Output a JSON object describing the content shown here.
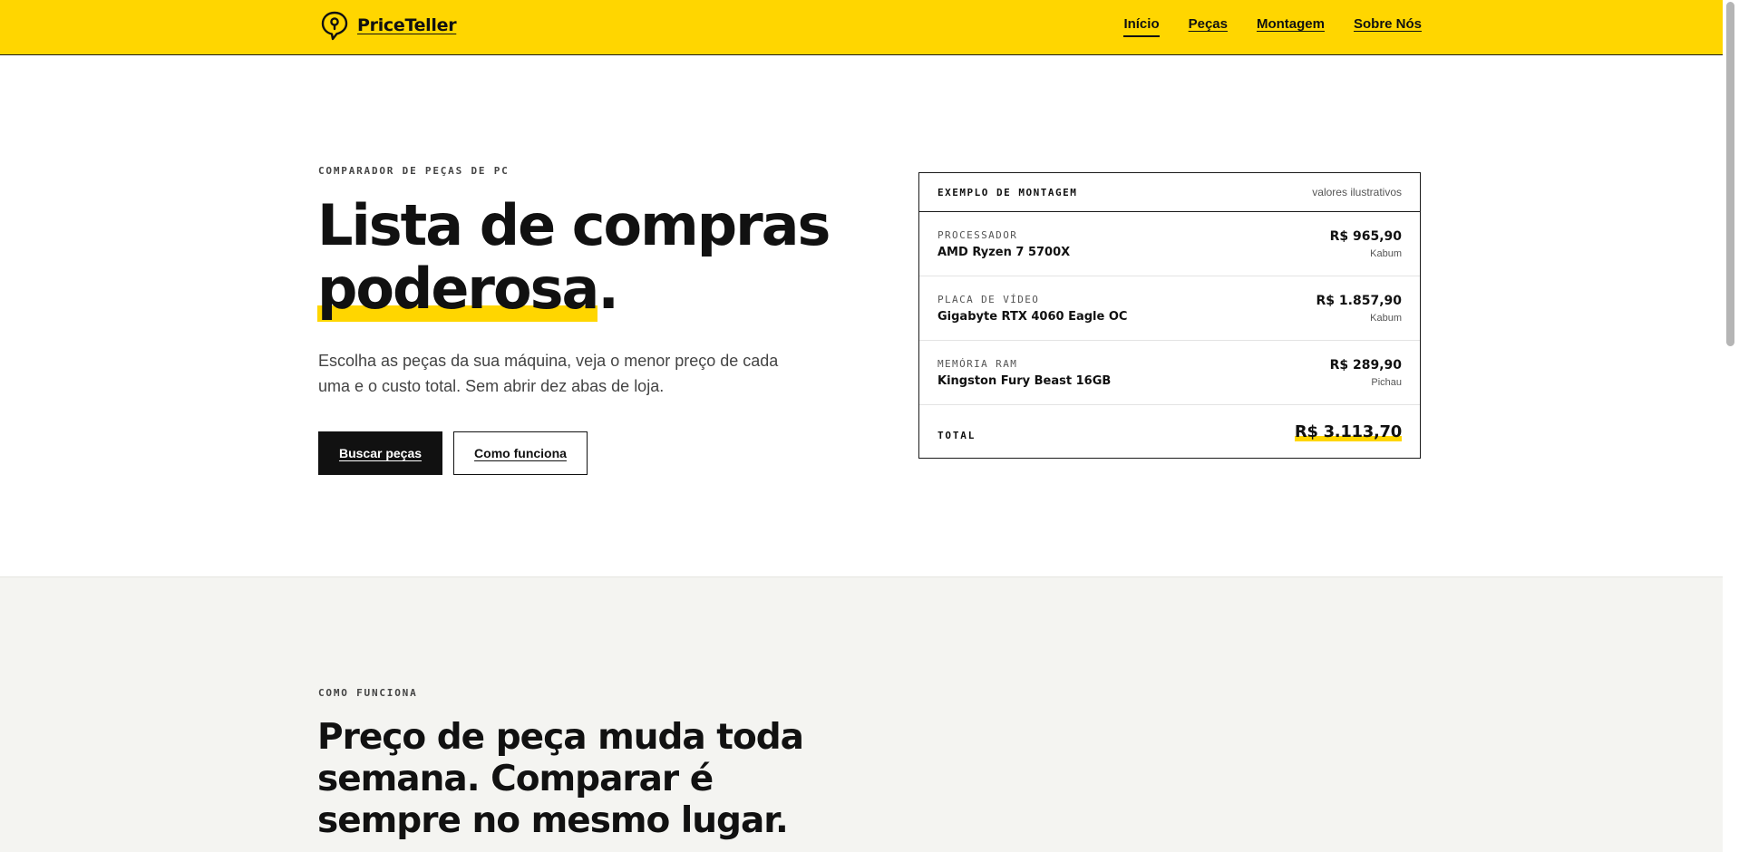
{
  "brand": {
    "name": "PriceTeller",
    "icon": "speech-bubble-logo-icon",
    "accent": "#ffd600"
  },
  "nav": {
    "items": [
      {
        "label": "Início",
        "active": true
      },
      {
        "label": "Peças",
        "active": false
      },
      {
        "label": "Montagem",
        "active": false
      },
      {
        "label": "Sobre Nós",
        "active": false
      }
    ]
  },
  "hero": {
    "eyebrow": "COMPARADOR DE PEÇAS DE PC",
    "title_line1": "Lista de compras",
    "title_highlight": "poderosa",
    "title_end": ".",
    "subtitle": "Escolha as peças da sua máquina, veja o menor preço de cada uma e o custo total. Sem abrir dez abas de loja.",
    "primary_button": "Buscar peças",
    "secondary_button": "Como funciona"
  },
  "example": {
    "title": "EXEMPLO DE MONTAGEM",
    "note": "valores ilustrativos",
    "items": [
      {
        "category": "PROCESSADOR",
        "name": "AMD Ryzen 7 5700X",
        "price": "R$ 965,90",
        "store": "Kabum"
      },
      {
        "category": "PLACA DE VÍDEO",
        "name": "Gigabyte RTX 4060 Eagle OC",
        "price": "R$ 1.857,90",
        "store": "Kabum"
      },
      {
        "category": "MEMÓRIA RAM",
        "name": "Kingston Fury Beast 16GB",
        "price": "R$ 289,90",
        "store": "Pichau"
      }
    ],
    "total_label": "TOTAL",
    "total_value": "R$ 3.113,70"
  },
  "how": {
    "eyebrow": "COMO FUNCIONA",
    "title": "Preço de peça muda toda semana. Comparar é sempre no mesmo lugar."
  }
}
